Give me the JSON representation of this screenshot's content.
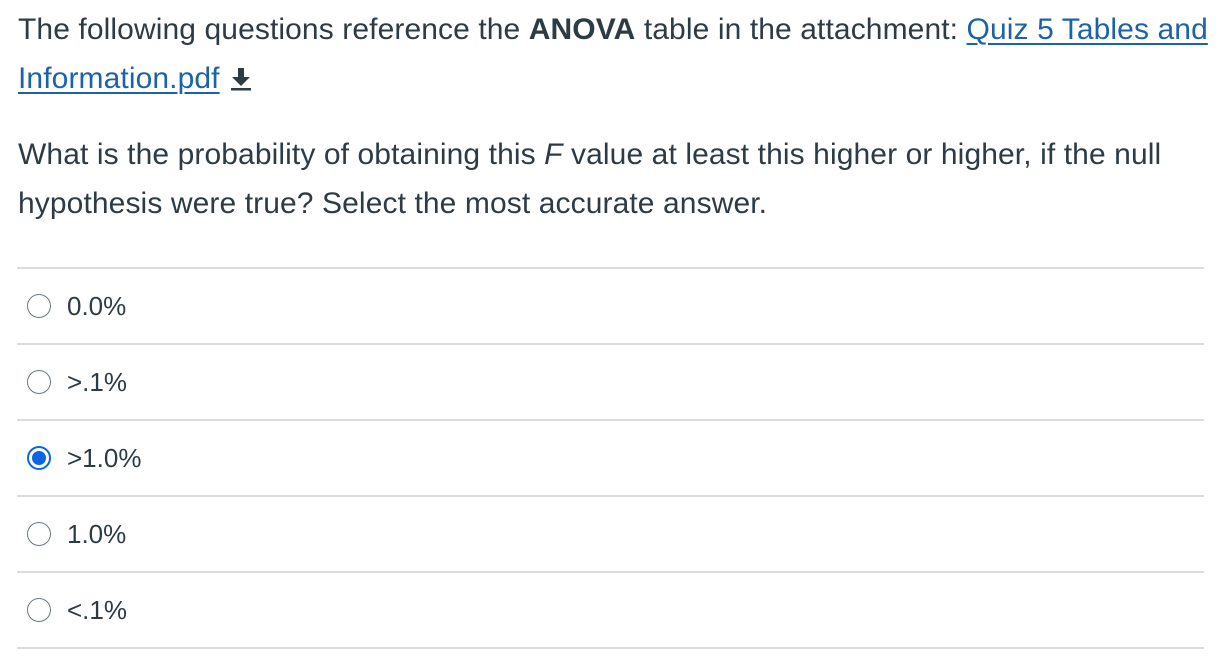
{
  "question": {
    "intro_prefix": "The following questions reference the ",
    "intro_bold": "ANOVA",
    "intro_suffix": " table in the attachment: ",
    "attachment_link": "Quiz 5 Tables and Information.pdf",
    "prompt_before": "What is the probability of obtaining this ",
    "prompt_italic": "F",
    "prompt_after": " value at least this higher or higher, if the null hypothesis were true? Select the most accurate answer."
  },
  "icons": {
    "download": "download-icon"
  },
  "colors": {
    "link": "#1d62a8",
    "selected_radio": "#0a64e8",
    "text": "#2d3b45",
    "divider": "#d9dde0"
  },
  "answers": [
    {
      "label": "0.0%",
      "selected": false
    },
    {
      "label": ">.1%",
      "selected": false
    },
    {
      "label": ">1.0%",
      "selected": true
    },
    {
      "label": "1.0%",
      "selected": false
    },
    {
      "label": "<.1%",
      "selected": false
    }
  ]
}
